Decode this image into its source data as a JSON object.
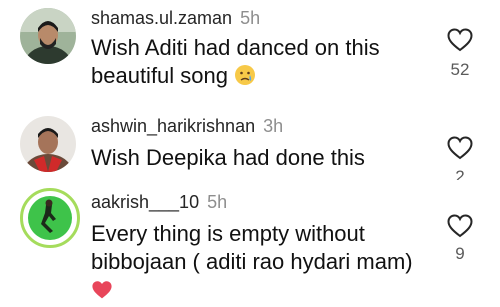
{
  "comments": [
    {
      "username": "shamas.ul.zaman",
      "time": "5h",
      "text_lines": [
        "Wish Aditi had danced on this",
        "beautiful song"
      ],
      "emoji": "sad-tear-emoji",
      "like_count": "52"
    },
    {
      "username": "ashwin_harikrishnan",
      "time": "3h",
      "text_lines": [
        "Wish Deepika had done this"
      ],
      "like_count": "2"
    },
    {
      "username": "aakrish___10",
      "time": "5h",
      "text_lines": [
        "Every thing is empty without",
        "bibbojaan ( aditi rao hydari mam)"
      ],
      "emoji": "red-heart-emoji",
      "like_count": "9"
    }
  ],
  "colors": {
    "username": "#262626",
    "time": "#8e8e8e",
    "heart_outline": "#262626",
    "story_ring": "#a5dc5c"
  }
}
